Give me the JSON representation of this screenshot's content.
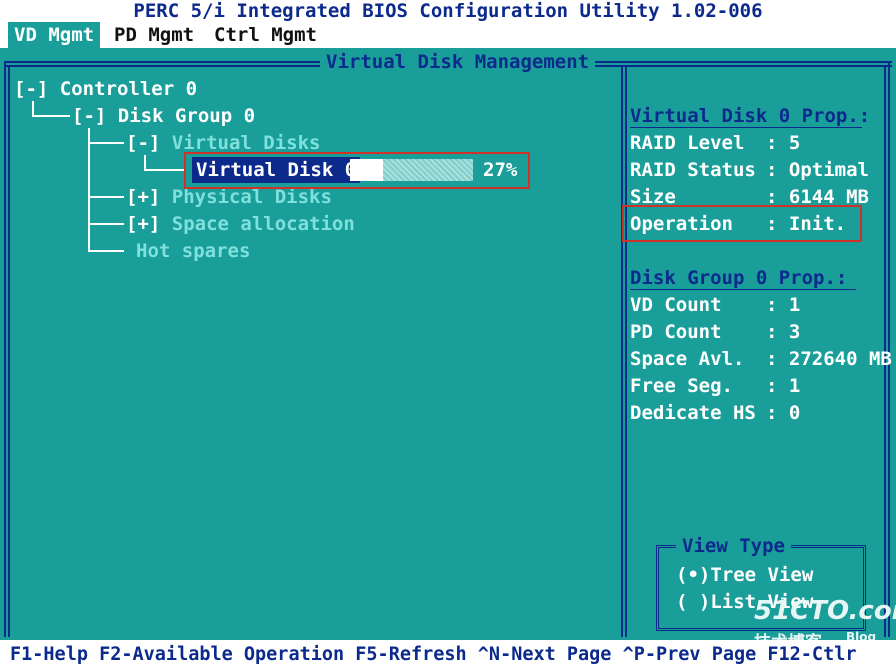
{
  "title": "PERC 5/i Integrated BIOS Configuration Utility 1.02-006",
  "menu": [
    "VD Mgmt",
    "PD Mgmt",
    "Ctrl Mgmt"
  ],
  "panel_title": "Virtual Disk Management",
  "tree": {
    "controller": "[-] Controller 0",
    "disk_group": "[-] Disk Group 0",
    "vd_toggle": "[-] ",
    "vd_label": "Virtual Disks",
    "vd0": "Virtual Disk 0",
    "vd0_progress_text": "27%",
    "vd0_progress": 0.27,
    "pd_toggle": "[+] ",
    "pd_label": "Physical Disks",
    "sa_toggle": "[+] ",
    "sa_label": "Space allocation",
    "hot_spares": "Hot spares"
  },
  "vd_props": {
    "heading": "Virtual Disk 0 Prop.:",
    "rows": [
      {
        "label": "RAID Level",
        "value": ": 5"
      },
      {
        "label": "RAID Status",
        "value": ": Optimal"
      },
      {
        "label": "Size",
        "value": ": 6144 MB"
      },
      {
        "label": "Operation",
        "value": ": Init."
      }
    ]
  },
  "dg_props": {
    "heading": "Disk Group 0 Prop.:",
    "rows": [
      {
        "label": "VD Count",
        "value": ": 1"
      },
      {
        "label": "PD Count",
        "value": ": 3"
      },
      {
        "label": "Space Avl.",
        "value": ": 272640 MB"
      },
      {
        "label": "Free Seg.",
        "value": ": 1"
      },
      {
        "label": "Dedicate HS",
        "value": ": 0"
      }
    ]
  },
  "view_type": {
    "title": "View Type",
    "options": [
      "(•)Tree View",
      "( )List View"
    ]
  },
  "status_bar": "F1-Help F2-Available Operation F5-Refresh ^N-Next Page ^P-Prev Page F12-Ctlr",
  "watermark": {
    "site": "51CTO.com",
    "sub": "技术博客",
    "blog": "Blog"
  },
  "colors": {
    "background": "#1a9e9a",
    "border": "#0c2a8c",
    "highlight": "#d0322a"
  }
}
